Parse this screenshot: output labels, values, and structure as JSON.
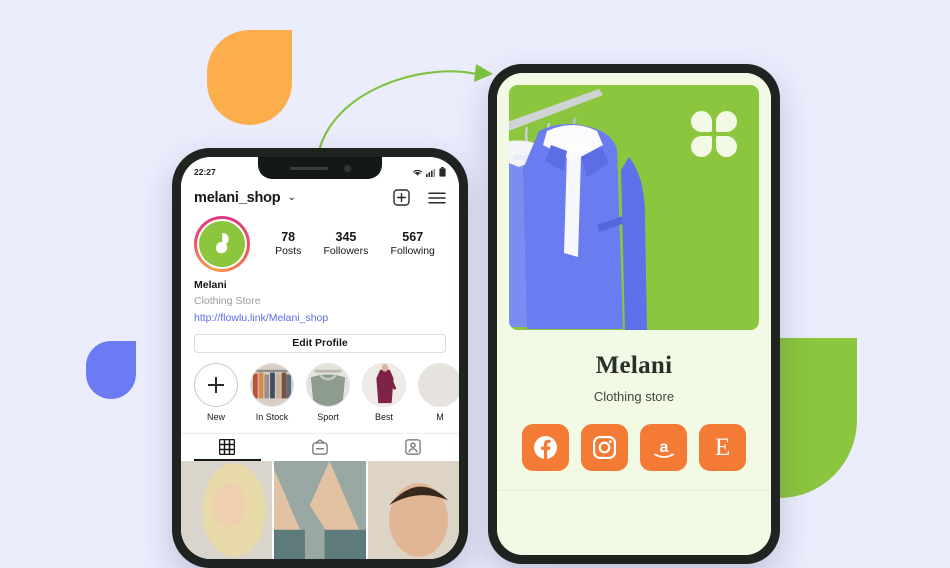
{
  "background_color": "#EBEDFD",
  "accents": {
    "green": "#8CC63E",
    "orange": "#F47B35",
    "peach": "#FBAE4B",
    "blue": "#6C7BF4",
    "link_blue": "#5B6BE8",
    "light_green": "#F2F9E4"
  },
  "shapes": {
    "orange_petal": "orange-petal-shape",
    "blue_petal": "blue-petal-shape",
    "green_block": "green-block-shape",
    "arrow": "curved-arrow"
  },
  "instagram_phone": {
    "status_bar": {
      "time": "22:27",
      "icons": [
        "wifi-icon",
        "signal-icon",
        "battery-icon"
      ]
    },
    "header": {
      "username": "melani_shop",
      "chevron": "⌄",
      "add_icon": "plus-square-icon",
      "menu_icon": "hamburger-menu-icon"
    },
    "avatar": {
      "name": "profile-avatar",
      "ring": "story-gradient-ring",
      "logo": "flowlu-logo"
    },
    "stats": [
      {
        "value": "78",
        "label": "Posts"
      },
      {
        "value": "345",
        "label": "Followers"
      },
      {
        "value": "567",
        "label": "Following"
      }
    ],
    "bio": {
      "name": "Melani",
      "category": "Clothing Store",
      "link": "http://flowlu.link/Melani_shop"
    },
    "edit_profile_label": "Edit Profile",
    "highlights": [
      {
        "label": "New",
        "icon": "plus-icon"
      },
      {
        "label": "In Stock",
        "icon": "clothing-rack-thumbnail"
      },
      {
        "label": "Sport",
        "icon": "sport-clothes-thumbnail"
      },
      {
        "label": "Best",
        "icon": "dress-thumbnail"
      },
      {
        "label": "M",
        "icon": "partial-thumbnail"
      }
    ],
    "tabs": [
      {
        "name": "grid-tab",
        "icon": "grid-icon",
        "active": true
      },
      {
        "name": "reels-tab",
        "icon": "igtv-icon",
        "active": false
      },
      {
        "name": "tagged-tab",
        "icon": "tagged-icon",
        "active": false
      }
    ],
    "photo_grid": [
      {
        "name": "photo-blonde-woman"
      },
      {
        "name": "photo-legs-jeans"
      },
      {
        "name": "photo-man-portrait"
      }
    ]
  },
  "landing_phone": {
    "hero": {
      "name": "hero-image-blue-blazers",
      "logo": "four-petal-flower-logo",
      "background_color": "#8CC63E"
    },
    "title": "Melani",
    "subtitle": "Clothing store",
    "socials": [
      {
        "name": "facebook-button",
        "icon": "facebook-icon",
        "glyph": "f"
      },
      {
        "name": "instagram-button",
        "icon": "instagram-icon",
        "glyph": ""
      },
      {
        "name": "amazon-button",
        "icon": "amazon-icon",
        "glyph": "a"
      },
      {
        "name": "etsy-button",
        "icon": "etsy-icon",
        "glyph": "E"
      }
    ]
  }
}
